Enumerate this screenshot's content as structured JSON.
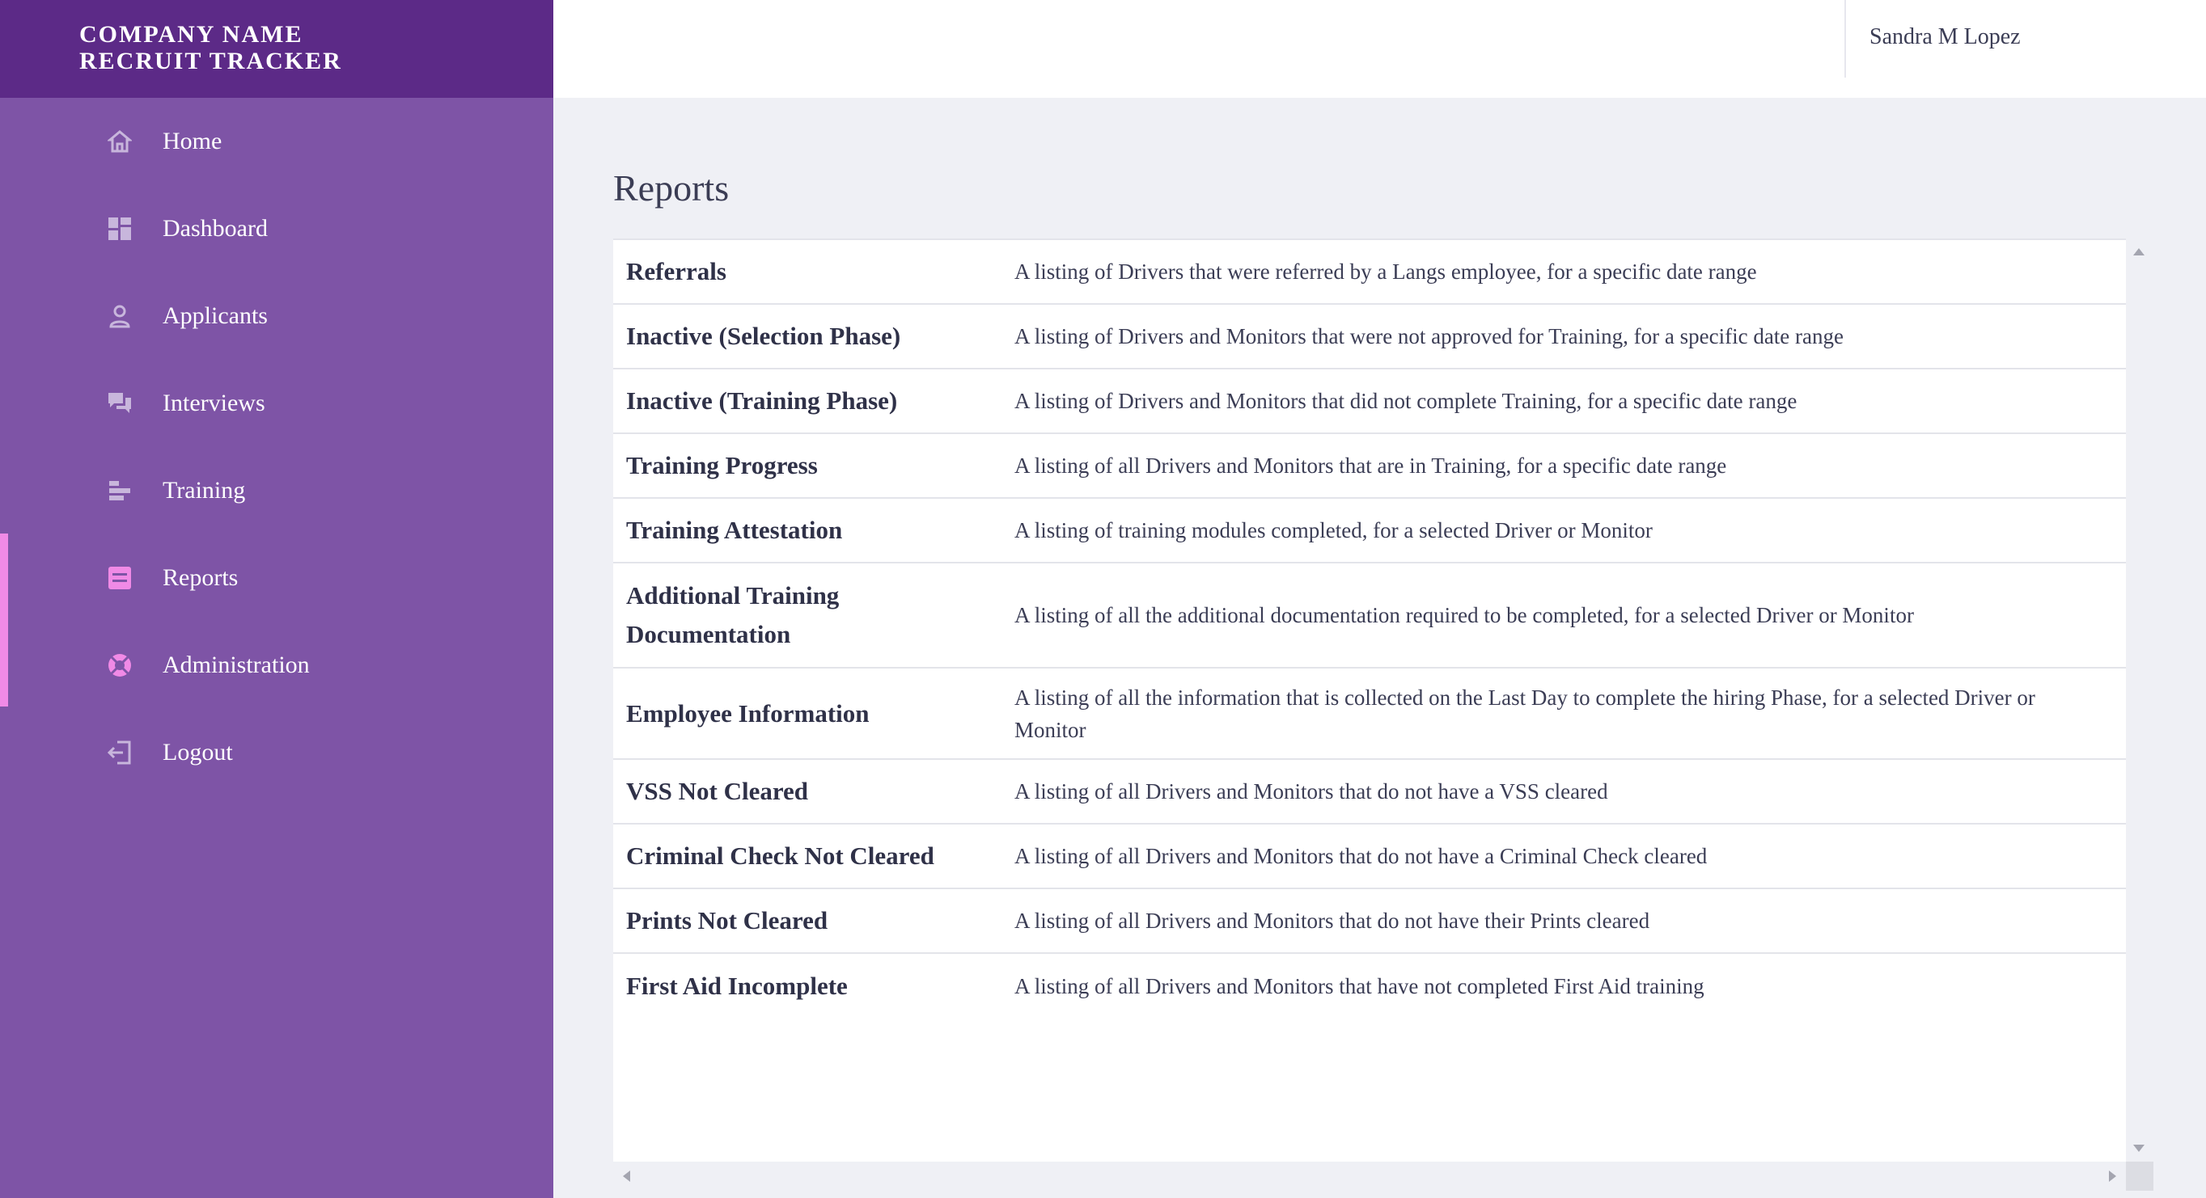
{
  "brand": {
    "line1": "COMPANY NAME",
    "line2": "RECRUIT TRACKER"
  },
  "header": {
    "user_name": "Sandra M Lopez"
  },
  "sidebar": {
    "accent_color": "#f08ae6",
    "items": [
      {
        "label": "Home",
        "icon": "home-icon"
      },
      {
        "label": "Dashboard",
        "icon": "dashboard-icon"
      },
      {
        "label": "Applicants",
        "icon": "user-icon"
      },
      {
        "label": "Interviews",
        "icon": "chat-icon"
      },
      {
        "label": "Training",
        "icon": "training-icon"
      },
      {
        "label": "Reports",
        "icon": "report-icon",
        "active": true
      },
      {
        "label": "Administration",
        "icon": "lifebuoy-icon",
        "active": true
      },
      {
        "label": "Logout",
        "icon": "logout-icon"
      }
    ]
  },
  "main": {
    "title": "Reports",
    "reports": [
      {
        "name": "Referrals",
        "description": "A listing of Drivers that were referred by a Langs employee, for a specific date range"
      },
      {
        "name": "Inactive (Selection Phase)",
        "description": "A listing of Drivers and Monitors that were not approved for Training, for a specific date range"
      },
      {
        "name": "Inactive (Training Phase)",
        "description": "A listing of Drivers and Monitors that did not complete Training, for a specific date range"
      },
      {
        "name": "Training Progress",
        "description": "A listing of all Drivers and Monitors that are in Training, for a specific date range"
      },
      {
        "name": "Training Attestation",
        "description": "A listing of training modules completed, for a selected Driver or Monitor"
      },
      {
        "name": "Additional Training Documentation",
        "description": "A listing of all the additional documentation required to be completed, for a selected Driver or Monitor"
      },
      {
        "name": "Employee Information",
        "description": "A listing of all the information that is collected on the Last Day to complete the hiring Phase, for a selected Driver or Monitor"
      },
      {
        "name": "VSS Not Cleared",
        "description": "A listing of all Drivers and Monitors that do not have a VSS cleared"
      },
      {
        "name": "Criminal Check Not Cleared",
        "description": "A listing of all Drivers and Monitors that do not have a Criminal Check cleared"
      },
      {
        "name": "Prints Not Cleared",
        "description": "A listing of all Drivers and Monitors that do not have their Prints cleared"
      },
      {
        "name": "First Aid Incomplete",
        "description": "A listing of all Drivers and Monitors that have not completed First Aid training"
      }
    ]
  }
}
